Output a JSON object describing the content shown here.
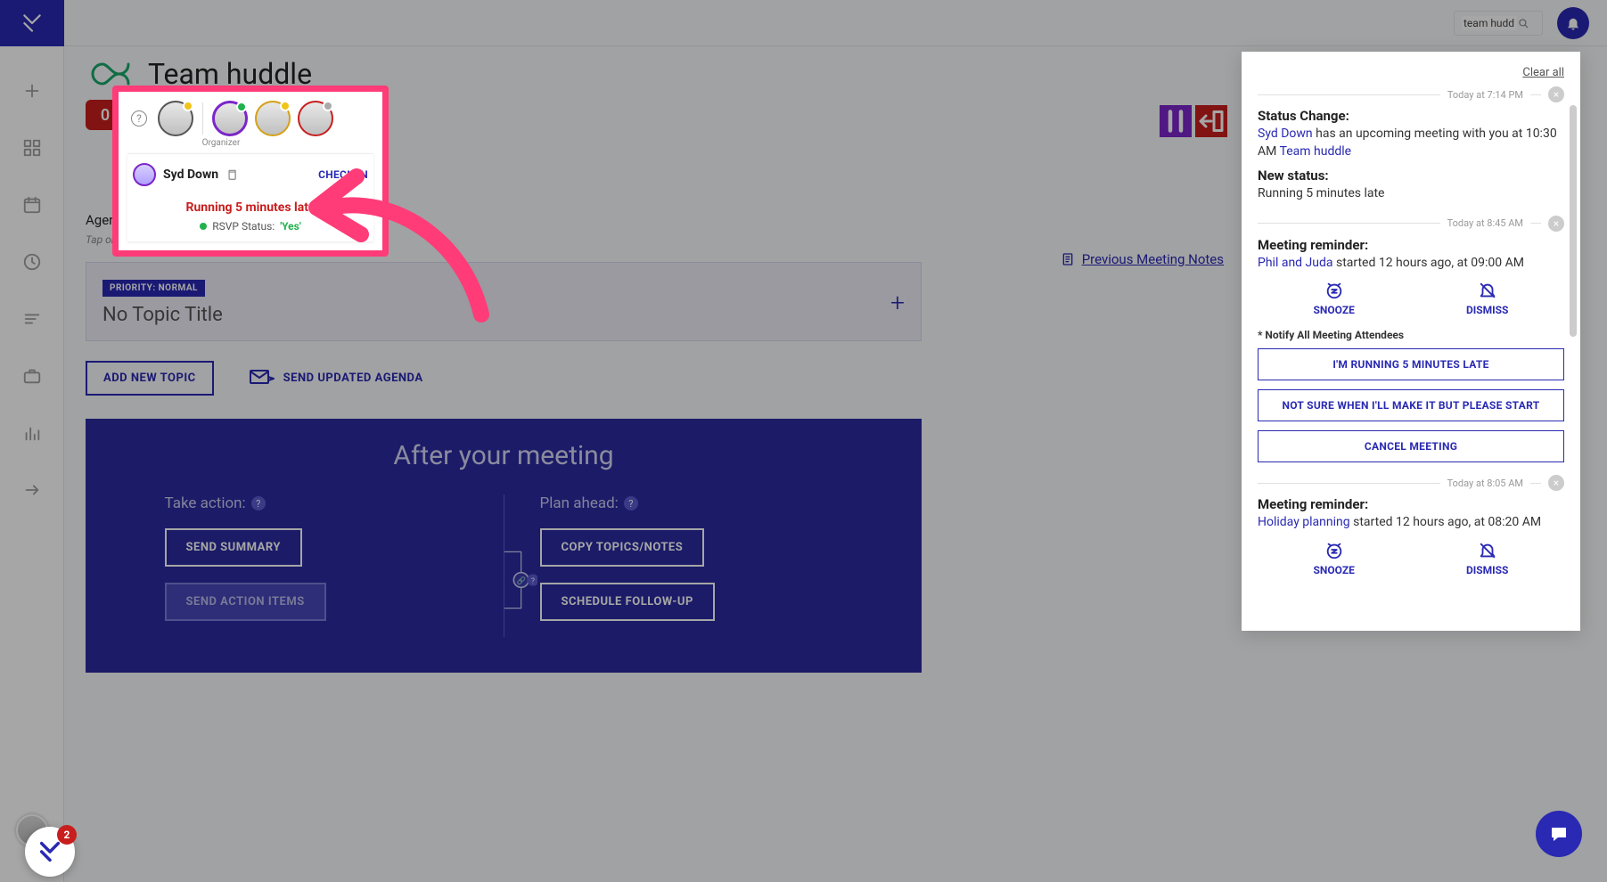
{
  "search": {
    "value": "team hudd"
  },
  "sidebar_icons": [
    "plus",
    "grid",
    "calendar",
    "clock",
    "list",
    "briefcase",
    "bars",
    "arrow-right"
  ],
  "helper_badge": "2",
  "page": {
    "title": "Team huddle",
    "timer": "0 :00",
    "agenda_label": "Agenda:",
    "agenda_hint": "Tap on a top",
    "prev_notes": "Previous Meeting Notes",
    "priority_tag": "PRIORITY: NORMAL",
    "topic_title": "No Topic Title",
    "add_topic": "ADD NEW TOPIC",
    "send_agenda": "SEND UPDATED AGENDA"
  },
  "after": {
    "heading": "After your meeting",
    "take_action": "Take action:",
    "plan_ahead": "Plan ahead:",
    "send_summary": "SEND SUMMARY",
    "send_action_items": "SEND ACTION ITEMS",
    "copy_topics": "COPY TOPICS/NOTES",
    "schedule_followup": "SCHEDULE FOLLOW-UP"
  },
  "popover": {
    "organizer_label": "Organizer",
    "name": "Syd Down",
    "checkin": "CHECK IN",
    "late": "Running 5 minutes late",
    "rsvp_label": "RSVP Status:",
    "rsvp_value": "'Yes'"
  },
  "notif": {
    "clear": "Clear all",
    "t1": "Today at 7:14 PM",
    "t2": "Today at 8:45 AM",
    "t3": "Today at 8:05 AM",
    "n1": {
      "h": "Status Change:",
      "p1a": "Syd Down",
      "p1b": " has an upcoming meeting with you at 10:30 AM ",
      "p1c": "Team huddle",
      "h2": "New status:",
      "p2": "Running 5 minutes late"
    },
    "n2": {
      "h": "Meeting reminder:",
      "link": "Phil and Juda",
      "rest": " started 12 hours ago, at 09:00 AM"
    },
    "snooze": "SNOOZE",
    "dismiss": "DISMISS",
    "notify_label": "* Notify All Meeting Attendees",
    "btn_late": "I'M RUNNING 5 MINUTES LATE",
    "btn_start": "NOT SURE WHEN I'LL MAKE IT BUT PLEASE START",
    "btn_cancel": "CANCEL MEETING",
    "n3": {
      "h": "Meeting reminder:",
      "link": "Holiday planning",
      "rest": " started 12 hours ago, at 08:20 AM"
    }
  }
}
